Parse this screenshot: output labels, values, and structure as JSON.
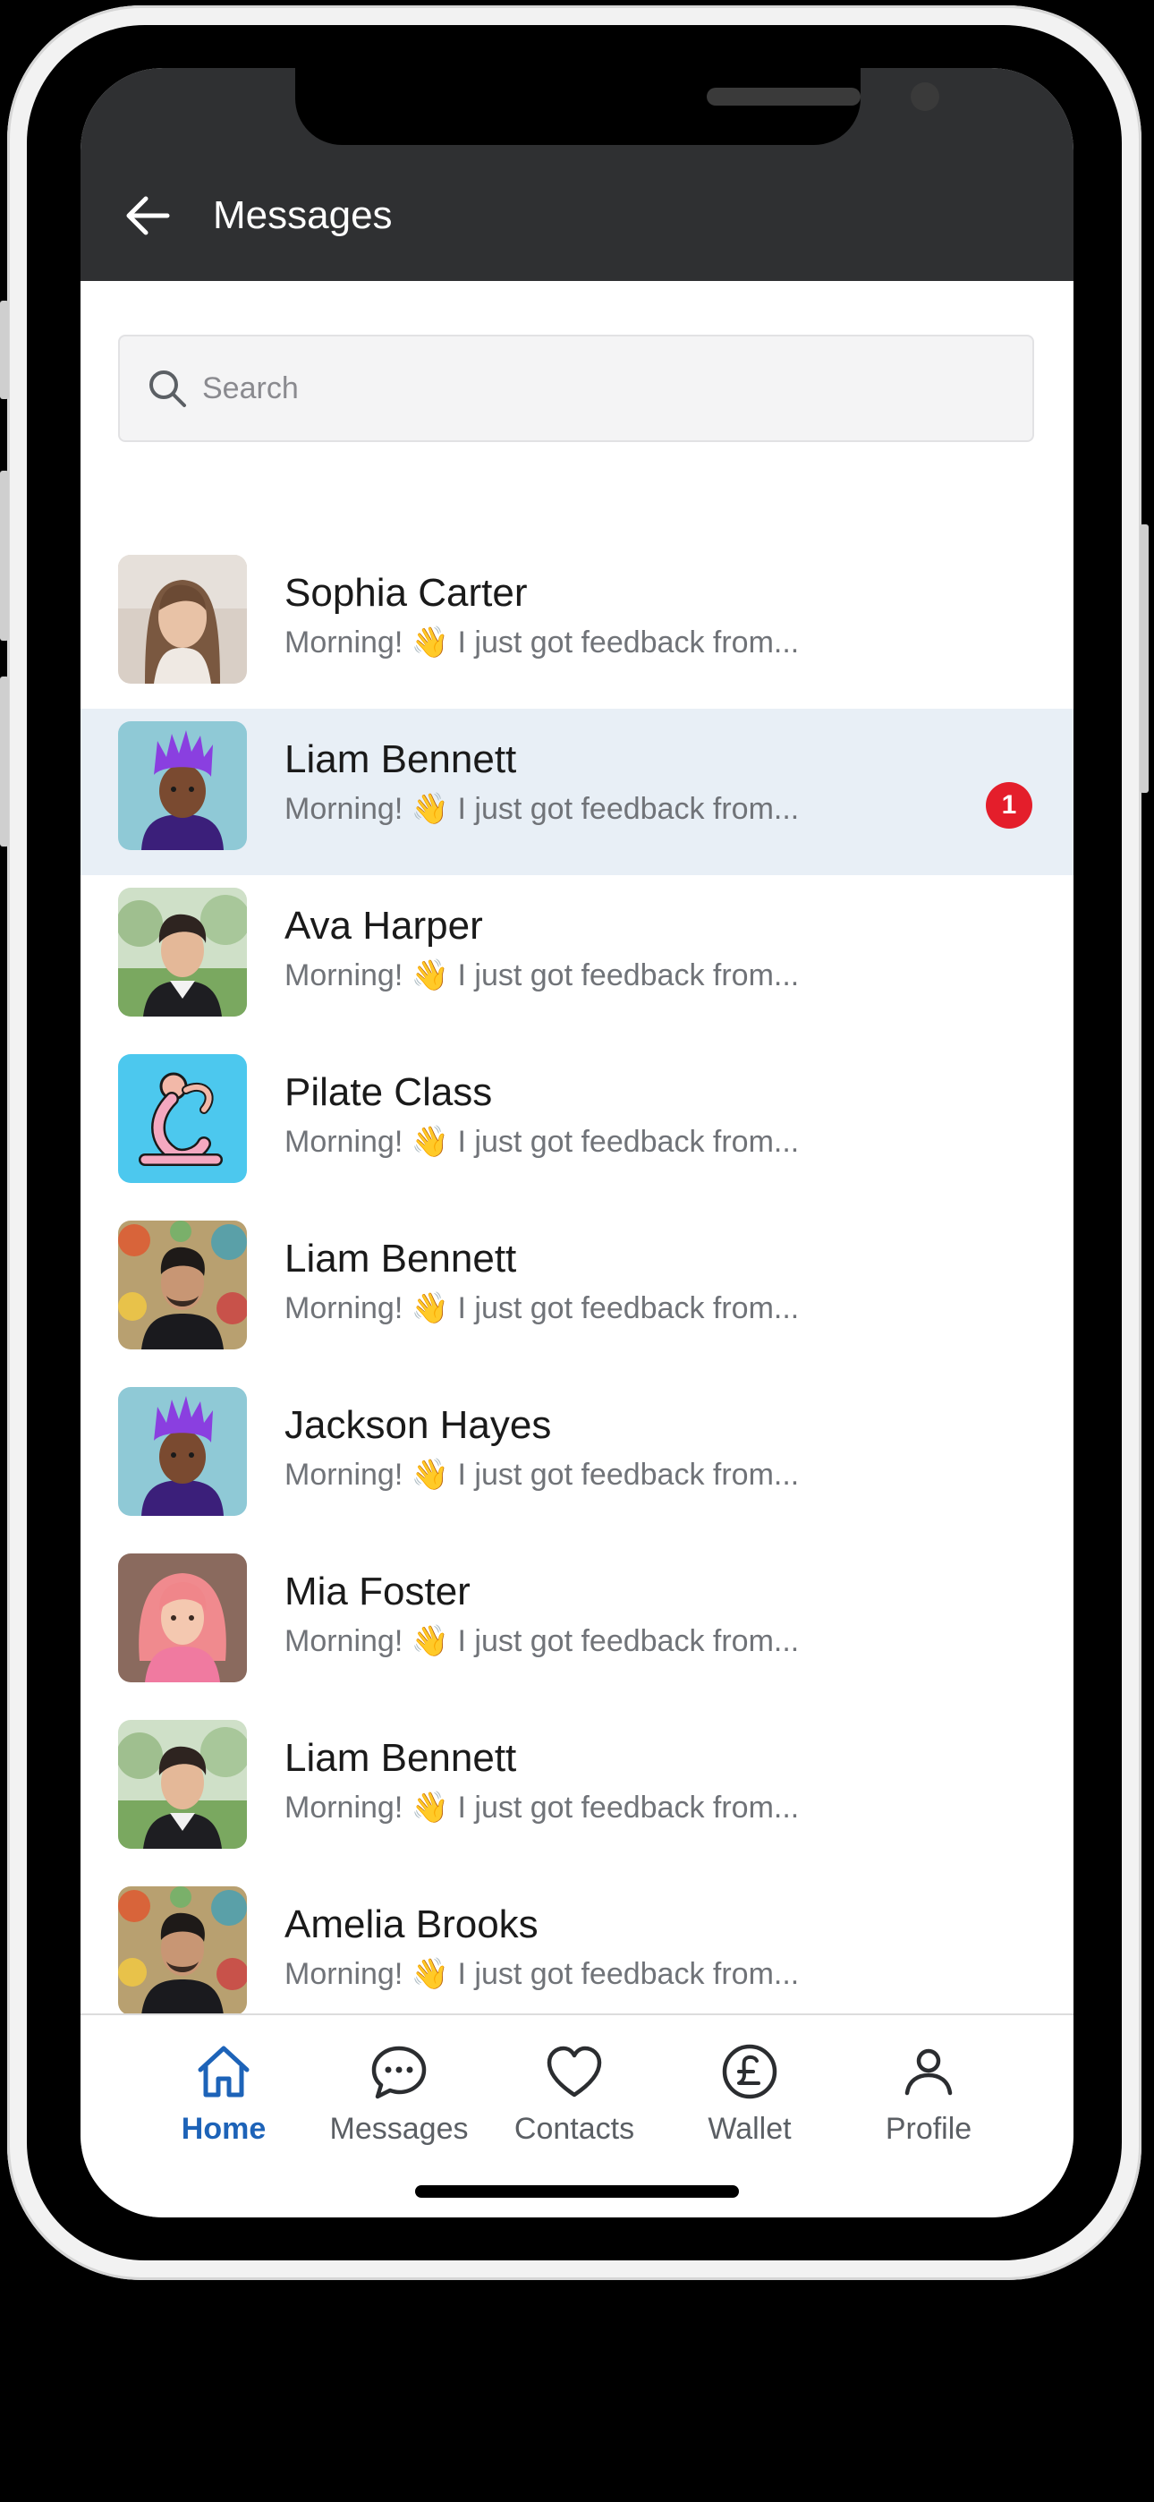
{
  "header": {
    "title": "Messages"
  },
  "search": {
    "placeholder": "Search"
  },
  "conversations": [
    {
      "name": "Sophia Carter",
      "preview": "Morning! 👋 I just got feedback from...",
      "avatar": "photo-woman-long-hair"
    },
    {
      "name": "Liam Bennett",
      "preview": "Morning! 👋 I just got feedback from...",
      "avatar": "cartoon-man-purple-hair",
      "unread": "1",
      "selected": true
    },
    {
      "name": "Ava Harper",
      "preview": "Morning! 👋 I just got feedback from...",
      "avatar": "photo-man-park"
    },
    {
      "name": "Pilate Class",
      "preview": "Morning! 👋 I just got feedback from...",
      "avatar": "yoga-pose-illustration"
    },
    {
      "name": "Liam Bennett",
      "preview": "Morning! 👋 I just got feedback from...",
      "avatar": "photo-man-floral-backdrop"
    },
    {
      "name": "Jackson Hayes",
      "preview": "Morning! 👋 I just got feedback from...",
      "avatar": "cartoon-man-purple-hair"
    },
    {
      "name": "Mia Foster",
      "preview": "Morning! 👋 I just got feedback from...",
      "avatar": "cartoon-woman-pink-hair"
    },
    {
      "name": "Liam Bennett",
      "preview": "Morning! 👋 I just got feedback from...",
      "avatar": "photo-man-park"
    },
    {
      "name": "Amelia Brooks",
      "preview": "Morning! 👋 I just got feedback from...",
      "avatar": "photo-man-floral-backdrop"
    }
  ],
  "tabs": [
    {
      "label": "Home",
      "icon": "home-icon",
      "active": true
    },
    {
      "label": "Messages",
      "icon": "chat-bubble-icon"
    },
    {
      "label": "Contacts",
      "icon": "heart-icon"
    },
    {
      "label": "Wallet",
      "icon": "pound-coin-icon"
    },
    {
      "label": "Profile",
      "icon": "person-icon"
    }
  ],
  "colors": {
    "header_bg": "#2f3032",
    "selected_row_bg": "#e8eff6",
    "badge": "#e41e2b",
    "active_tab": "#1d63b8"
  }
}
